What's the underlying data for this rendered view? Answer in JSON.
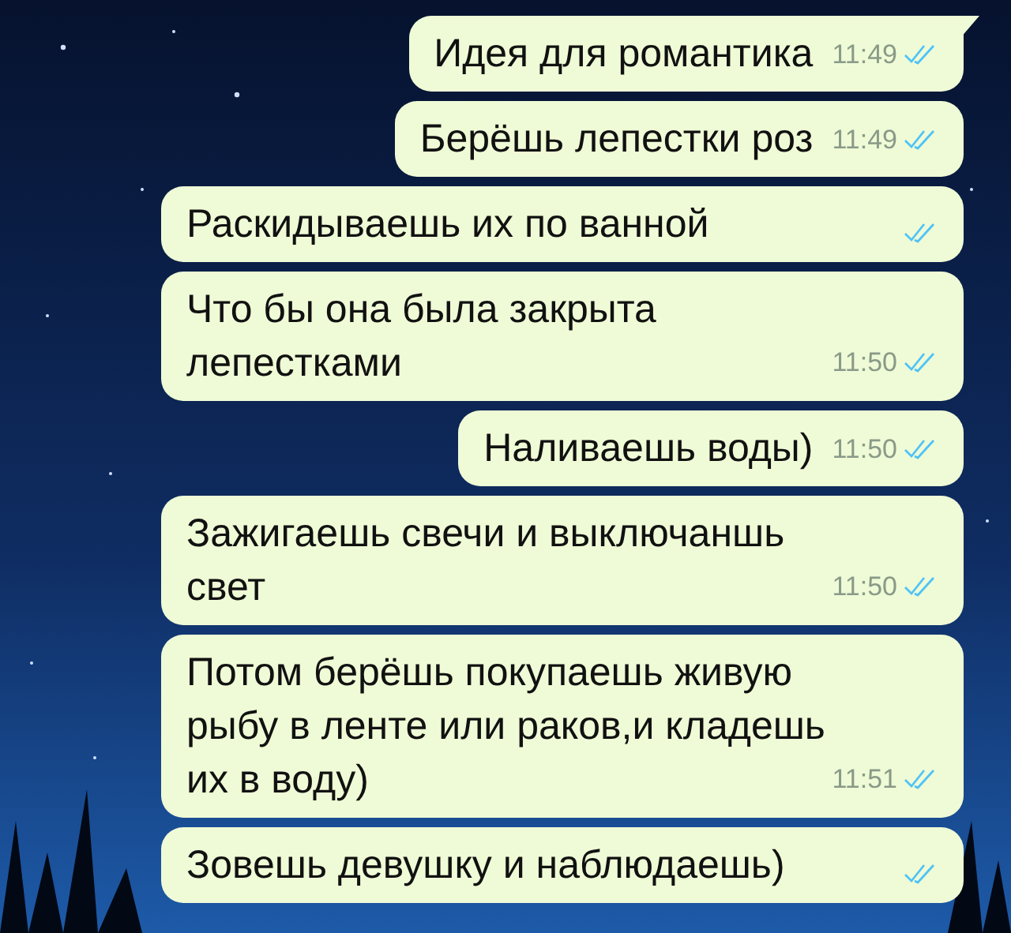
{
  "messages": [
    {
      "text": "Идея для романтика",
      "time": "11:49",
      "read": true,
      "tail": true
    },
    {
      "text": "Берёшь лепестки роз",
      "time": "11:49",
      "read": true,
      "tail": false
    },
    {
      "text": "Раскидываешь их по ванной",
      "read": true,
      "tail": false
    },
    {
      "text": "Что бы она была закрыта\nлепестками",
      "time": "11:50",
      "read": true,
      "tail": false
    },
    {
      "text": "Наливаешь воды)",
      "time": "11:50",
      "read": true,
      "tail": false
    },
    {
      "text": "Зажигаешь свечи и выключаншь\nсвет",
      "time": "11:50",
      "read": true,
      "tail": false
    },
    {
      "text": "Потом берёшь покупаешь живую\nрыбу в ленте или раков,и кладешь\nих в воду)",
      "time": "11:51",
      "read": true,
      "tail": false
    },
    {
      "text": "Зовешь девушку и наблюдаешь)",
      "read": true,
      "tail": false
    }
  ]
}
